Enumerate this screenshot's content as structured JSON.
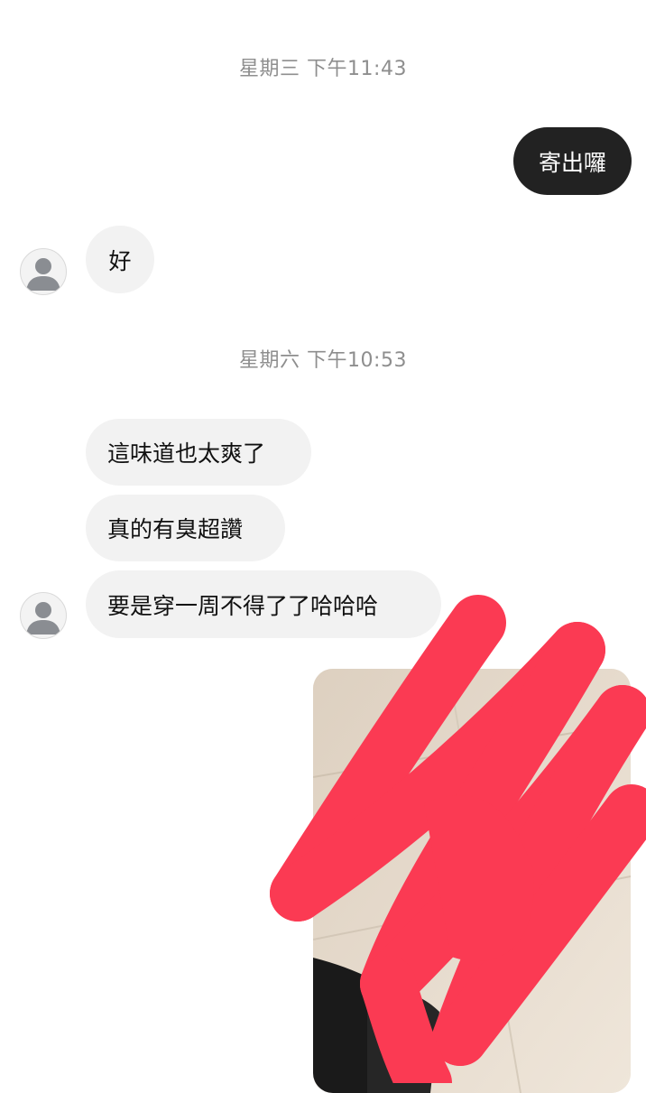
{
  "conversation": {
    "groups": [
      {
        "timestamp": "星期三 下午11:43",
        "messages": [
          {
            "direction": "outgoing",
            "text": "寄出囉"
          },
          {
            "direction": "incoming",
            "text": "好"
          }
        ]
      },
      {
        "timestamp": "星期六 下午10:53",
        "messages": [
          {
            "direction": "incoming",
            "text": "這味道也太爽了"
          },
          {
            "direction": "incoming",
            "text": "真的有臭超讚"
          },
          {
            "direction": "incoming",
            "text": "要是穿一周不得了了哈哈哈"
          },
          {
            "direction": "outgoing",
            "type": "photo",
            "redacted": true
          }
        ]
      }
    ]
  },
  "avatar": {
    "icon": "default-user-icon"
  },
  "colors": {
    "outgoing_bubble": "#222222",
    "incoming_bubble": "#f2f2f2",
    "timestamp_text": "#8e8e8e",
    "redaction_scribble": "#fb3a53"
  }
}
